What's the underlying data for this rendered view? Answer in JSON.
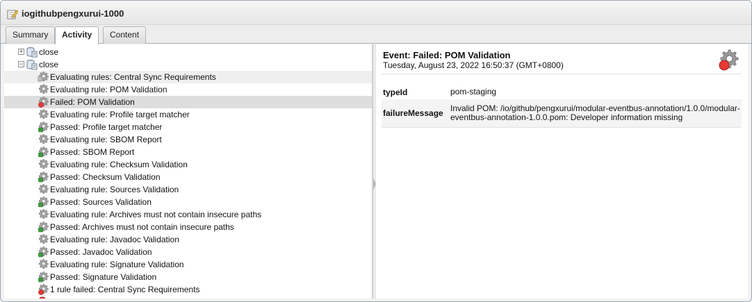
{
  "window": {
    "title": "iogithubpengxurui-1000"
  },
  "tabs": [
    {
      "label": "Summary",
      "active": false
    },
    {
      "label": "Activity",
      "active": true
    },
    {
      "label": "Content",
      "active": false
    }
  ],
  "tree": {
    "repo_nodes": [
      {
        "label": "close",
        "expanded": false
      },
      {
        "label": "close",
        "expanded": true
      }
    ],
    "events": [
      {
        "label": "Evaluating rules: Central Sync Requirements",
        "status": "evaluating",
        "highlight": "hover"
      },
      {
        "label": "Evaluating rule: POM Validation",
        "status": "evaluating"
      },
      {
        "label": "Failed: POM Validation",
        "status": "failed",
        "highlight": "selected"
      },
      {
        "label": "Evaluating rule: Profile target matcher",
        "status": "evaluating"
      },
      {
        "label": "Passed: Profile target matcher",
        "status": "passed"
      },
      {
        "label": "Evaluating rule: SBOM Report",
        "status": "evaluating"
      },
      {
        "label": "Passed: SBOM Report",
        "status": "passed"
      },
      {
        "label": "Evaluating rule: Checksum Validation",
        "status": "evaluating"
      },
      {
        "label": "Passed: Checksum Validation",
        "status": "passed"
      },
      {
        "label": "Evaluating rule: Sources Validation",
        "status": "evaluating"
      },
      {
        "label": "Passed: Sources Validation",
        "status": "passed"
      },
      {
        "label": "Evaluating rule: Archives must not contain insecure paths",
        "status": "evaluating"
      },
      {
        "label": "Passed: Archives must not contain insecure paths",
        "status": "passed"
      },
      {
        "label": "Evaluating rule: Javadoc Validation",
        "status": "evaluating"
      },
      {
        "label": "Passed: Javadoc Validation",
        "status": "passed"
      },
      {
        "label": "Evaluating rule: Signature Validation",
        "status": "evaluating"
      },
      {
        "label": "Passed: Signature Validation",
        "status": "passed"
      },
      {
        "label": "1 rule failed: Central Sync Requirements",
        "status": "rule-failed"
      }
    ]
  },
  "detail": {
    "title": "Event: Failed: POM Validation",
    "date": "Tuesday, August 23, 2022 16:50:37 (GMT+0800)",
    "properties": [
      {
        "key": "typeId",
        "value": "pom-staging"
      },
      {
        "key": "failureMessage",
        "value": "Invalid POM: /io/github/pengxurui/modular-eventbus-annotation/1.0.0/modular-eventbus-annotation-1.0.0.pom: Developer information missing"
      }
    ]
  },
  "colors": {
    "failed": "#e53935",
    "passed": "#3a9d3a",
    "gear": "#8a8a8a",
    "selected_row": "#dedede"
  }
}
